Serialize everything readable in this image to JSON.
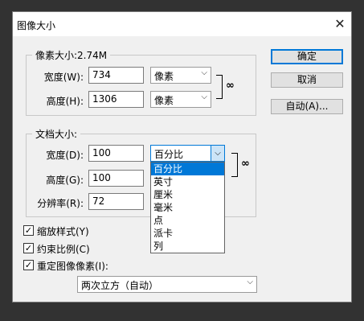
{
  "window": {
    "title": "图像大小",
    "close_glyph": "✕"
  },
  "pixel_dims": {
    "title": "像素大小:2.74M",
    "width": {
      "label": "宽度(W):",
      "value": "734",
      "unit": "像素"
    },
    "height": {
      "label": "高度(H):",
      "value": "1306",
      "unit": "像素"
    }
  },
  "doc_size": {
    "title": "文档大小:",
    "width": {
      "label": "宽度(D):",
      "value": "100",
      "unit": "百分比"
    },
    "height": {
      "label": "高度(G):",
      "value": "100"
    },
    "resolution": {
      "label": "分辨率(R):",
      "value": "72"
    }
  },
  "unit_dropdown": {
    "options": [
      "百分比",
      "英寸",
      "厘米",
      "毫米",
      "点",
      "派卡",
      "列"
    ],
    "selected_index": 0
  },
  "buttons": {
    "ok": "确定",
    "cancel": "取消",
    "auto": "自动(A)..."
  },
  "options": {
    "scale_styles": {
      "label": "缩放样式(Y)",
      "checked": true
    },
    "constrain": {
      "label": "约束比例(C)",
      "checked": true
    },
    "resample": {
      "label": "重定图像像素(I):",
      "checked": true
    },
    "resample_method": "两次立方（自动）"
  },
  "colors": {
    "accent": "#0078d7",
    "background": "#323232",
    "dialog": "#f0f0f0"
  },
  "icons": {
    "link": "chain-link-icon",
    "dropdown_arrow": "chevron-down-icon",
    "check": "checkmark-icon"
  }
}
